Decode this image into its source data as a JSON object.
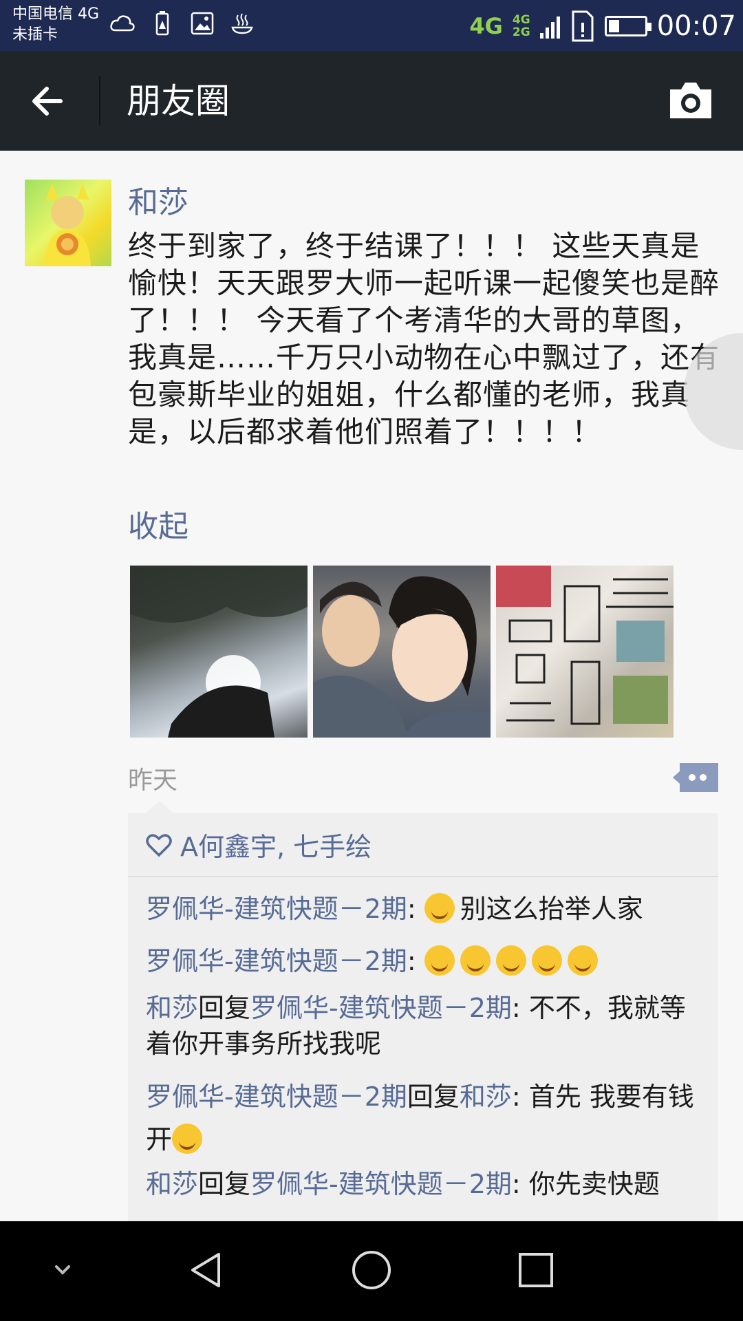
{
  "status_bar": {
    "carrier_line1": "中国电信 4G",
    "carrier_line2": "未插卡",
    "network": "4G",
    "network_small_top": "4G",
    "network_small_bottom": "2G",
    "battery_level_percent": 30,
    "time": "00:07"
  },
  "header": {
    "title": "朋友圈",
    "back_icon": "arrow-left-icon",
    "camera_icon": "camera-icon"
  },
  "post": {
    "username": "和莎",
    "text": "终于到家了，终于结课了！！！ 这些天真是愉快！天天跟罗大师一起听课一起傻笑也是醉了！！！ 今天看了个考清华的大哥的草图，我真是……千万只小动物在心中飘过了，还有包豪斯毕业的姐姐，什么都懂的老师，我真是，以后都求着他们照着了！！！！",
    "collapse_label": "收起",
    "time": "昨天",
    "likes": "A何鑫宇, 七手绘",
    "comments": [
      {
        "author": "罗佩华-建筑快题－2期",
        "sep": ": ",
        "emoji_prefix": true,
        "text": "别这么抬举人家"
      },
      {
        "author": "罗佩华-建筑快题－2期",
        "sep": ": ",
        "emoji_count": 5
      },
      {
        "author": "和莎",
        "reply_word": "回复",
        "target": "罗佩华-建筑快题－2期",
        "sep": ": ",
        "text": "不不，我就等着你开事务所找我呢"
      },
      {
        "author": "罗佩华-建筑快题－2期",
        "reply_word": "回复",
        "target": "和莎",
        "sep": ": ",
        "text": "首先 我要有钱开"
      },
      {
        "author": "和莎",
        "reply_word": "回复",
        "target": "罗佩华-建筑快题－2期",
        "sep": ": ",
        "text": "你先卖快题"
      }
    ]
  },
  "nav": {
    "icons": [
      "chevron-down-icon",
      "back-triangle-icon",
      "home-circle-icon",
      "recents-square-icon"
    ]
  },
  "colors": {
    "status_bar": "#1f2a52",
    "title_bar": "#202529",
    "link_blue": "#576b95",
    "network_green": "#8fd14f"
  }
}
